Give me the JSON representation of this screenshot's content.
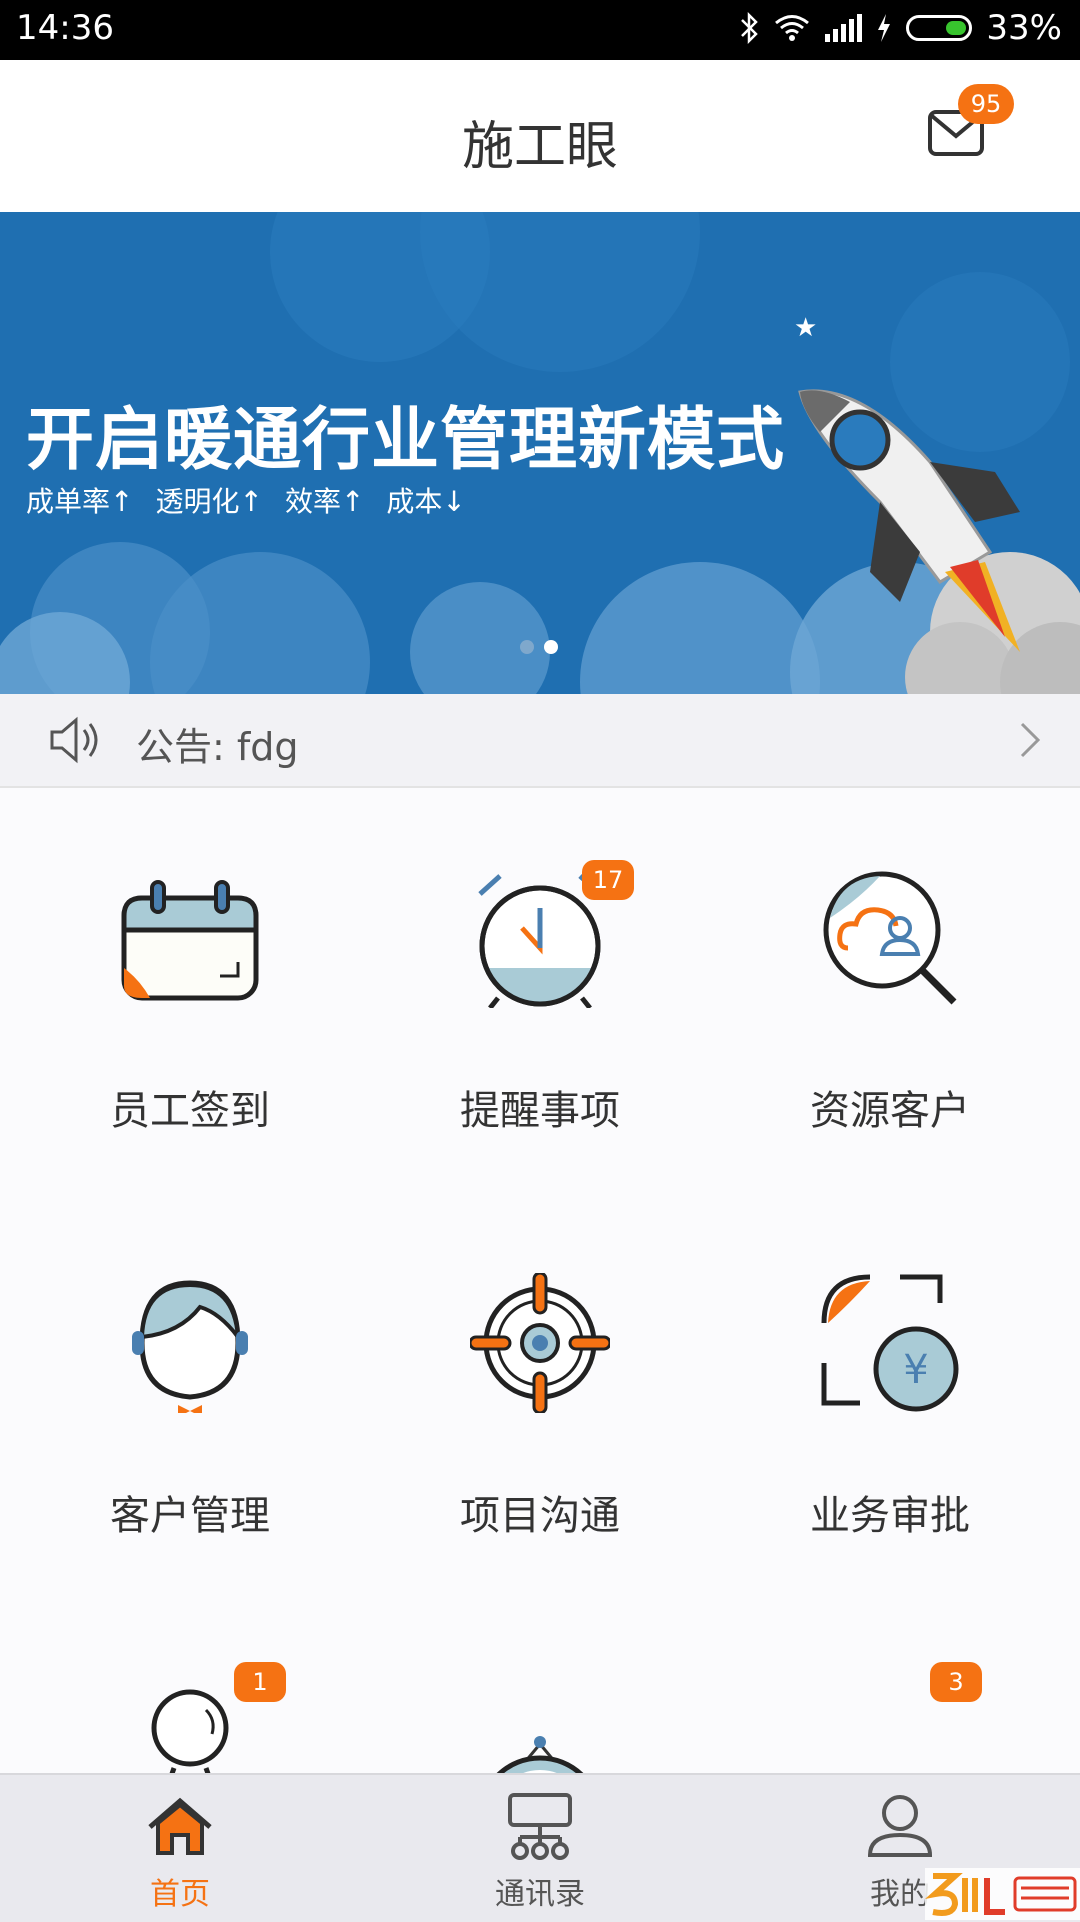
{
  "status_bar": {
    "time": "14:36",
    "battery": "33%"
  },
  "header": {
    "title": "施工眼",
    "mail_badge": "95"
  },
  "banner": {
    "headline": "开启暖通行业管理新模式",
    "tags": [
      "成单率↑",
      "透明化↑",
      "效率↑",
      "成本↓"
    ],
    "page_count": 2,
    "active_page": 2
  },
  "notice": {
    "text": "公告: fdg"
  },
  "grid": [
    {
      "label": "员工签到",
      "icon": "calendar-icon",
      "badge": ""
    },
    {
      "label": "提醒事项",
      "icon": "alarm-clock-icon",
      "badge": "17"
    },
    {
      "label": "资源客户",
      "icon": "search-customer-icon",
      "badge": ""
    },
    {
      "label": "客户管理",
      "icon": "customer-avatar-icon",
      "badge": ""
    },
    {
      "label": "项目沟通",
      "icon": "target-icon",
      "badge": ""
    },
    {
      "label": "业务审批",
      "icon": "yuan-approval-icon",
      "badge": ""
    },
    {
      "label": "",
      "icon": "person-icon",
      "badge": "1"
    },
    {
      "label": "",
      "icon": "clock-icon",
      "badge": ""
    },
    {
      "label": "",
      "icon": "glasses-icon",
      "badge": "3"
    }
  ],
  "tabs": [
    {
      "label": "首页",
      "icon": "home-icon",
      "active": true
    },
    {
      "label": "通讯录",
      "icon": "org-chart-icon",
      "active": false
    },
    {
      "label": "我的",
      "icon": "user-icon",
      "active": false
    }
  ],
  "colors": {
    "accent": "#f57213",
    "banner_blue": "#1f6fb1",
    "icon_teal": "#a9cbd6",
    "icon_outline": "#222222"
  }
}
